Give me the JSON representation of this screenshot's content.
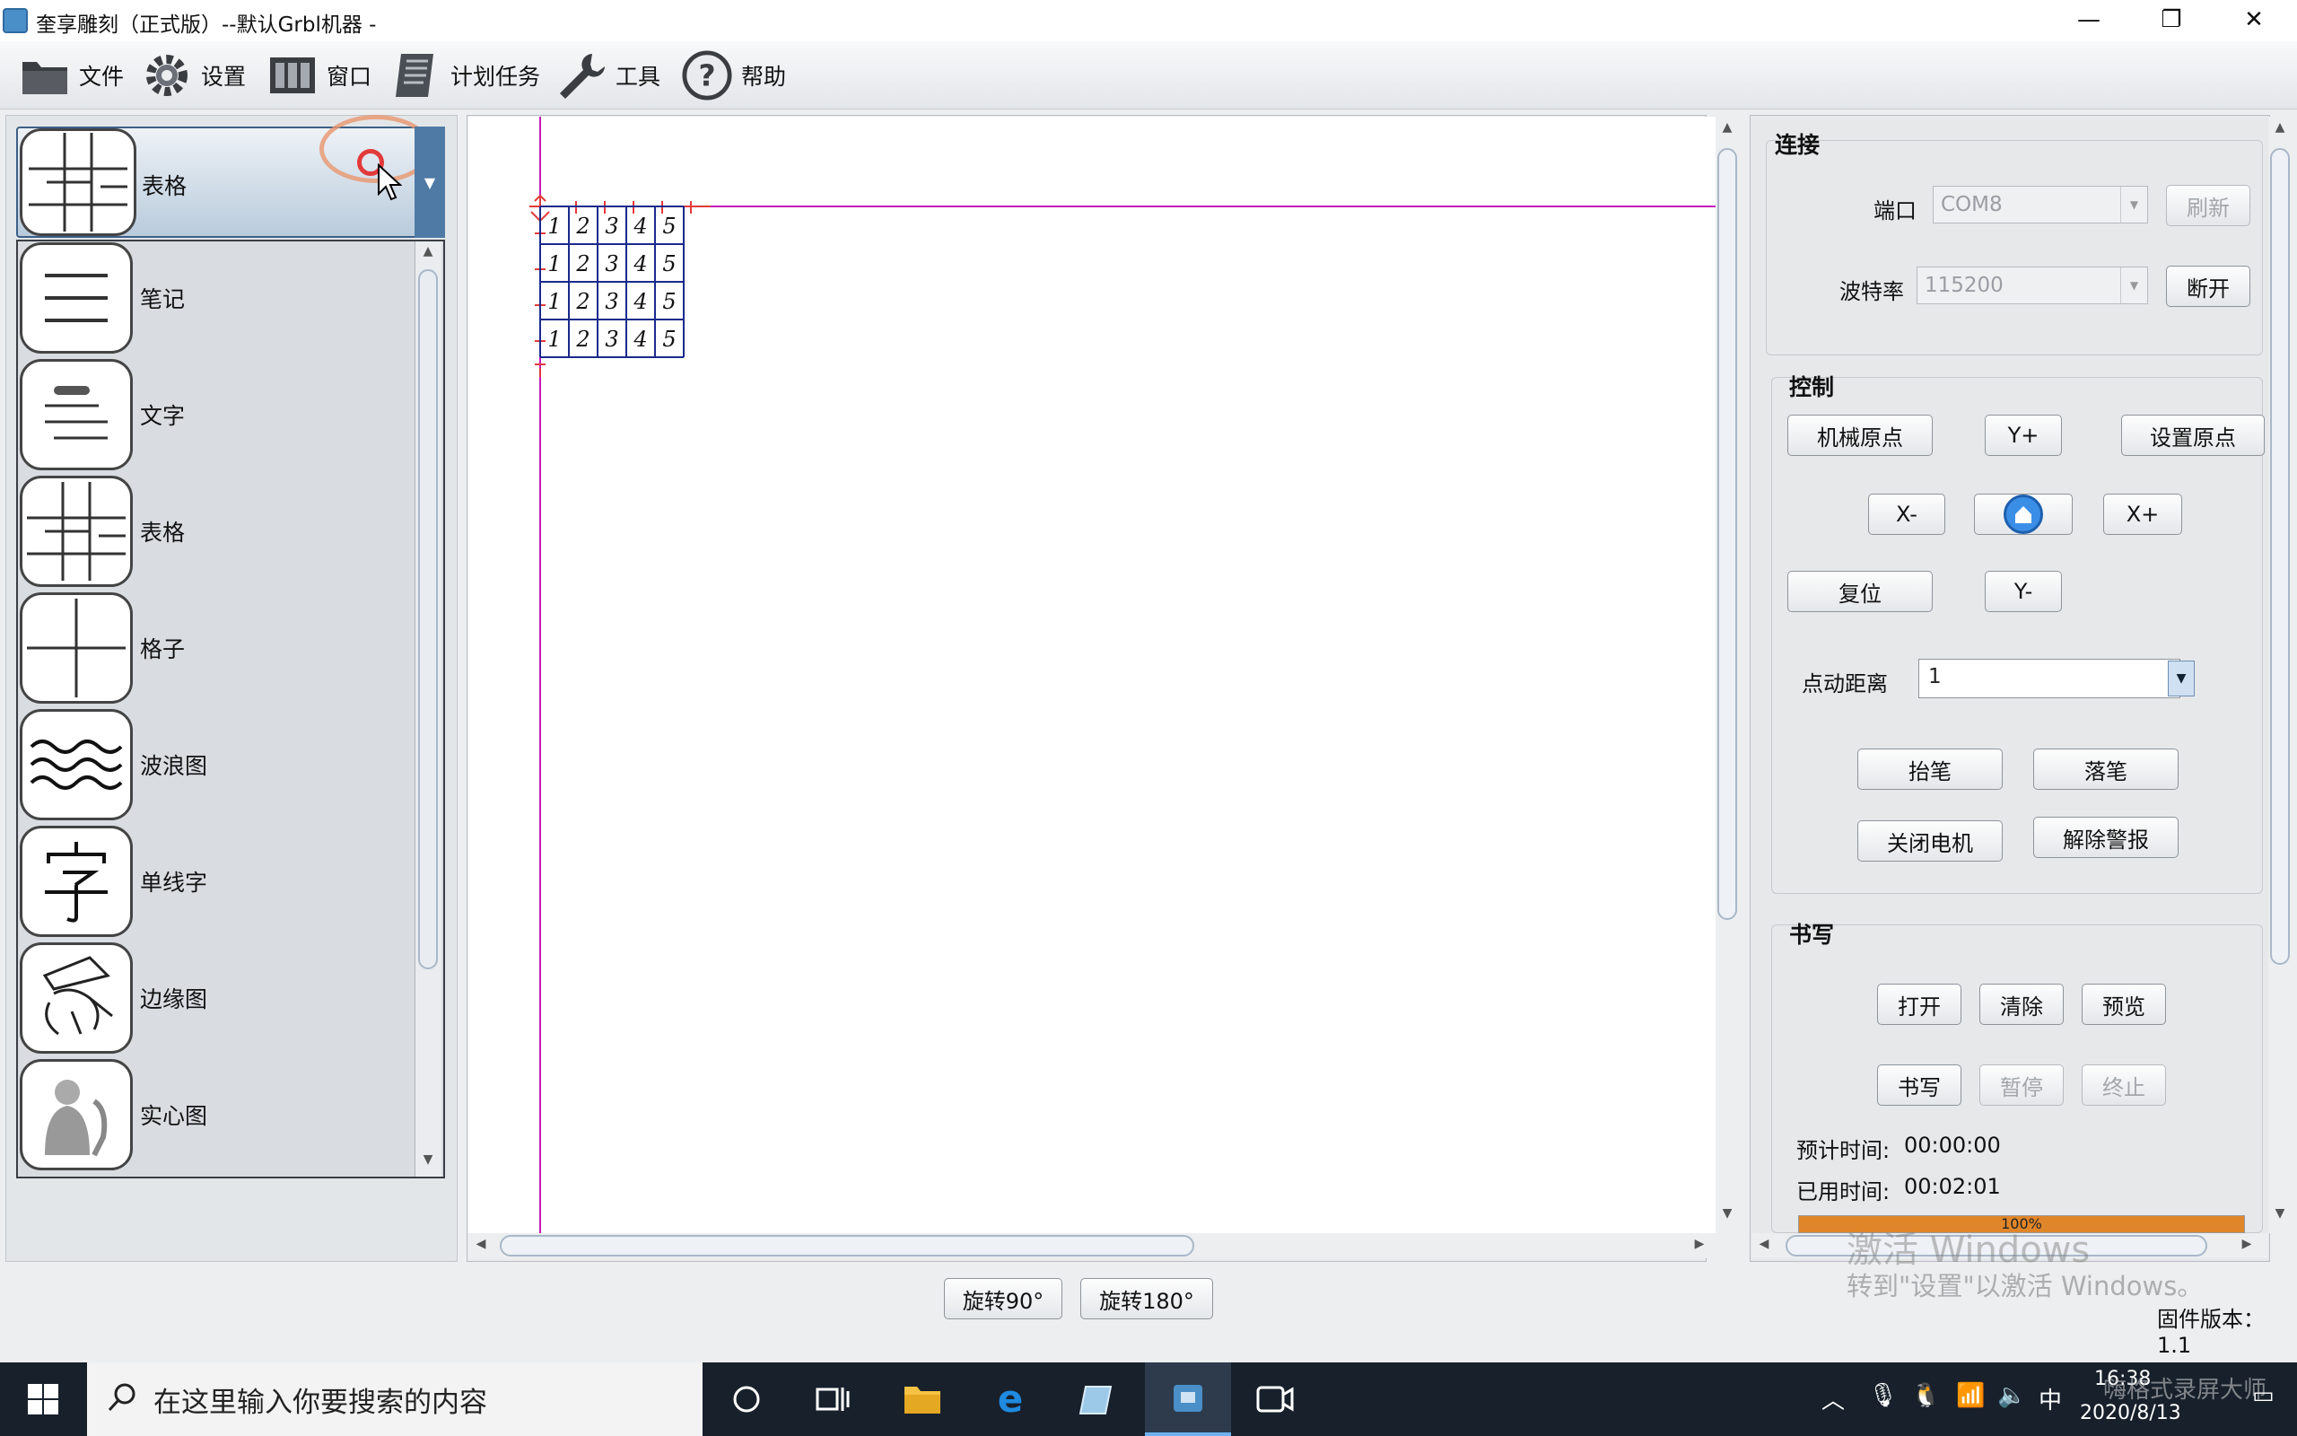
{
  "window": {
    "title": "奎享雕刻（正式版）--默认Grbl机器 -",
    "minimize": "—",
    "maximize": "❐",
    "close": "✕"
  },
  "menu": [
    {
      "label": "文件",
      "icon": "folder-icon"
    },
    {
      "label": "设置",
      "icon": "gear-icon"
    },
    {
      "label": "窗口",
      "icon": "window-icon"
    },
    {
      "label": "计划任务",
      "icon": "scroll-icon"
    },
    {
      "label": "工具",
      "icon": "wrench-icon"
    },
    {
      "label": "帮助",
      "icon": "help-icon"
    }
  ],
  "left": {
    "selected": "表格",
    "items": [
      "笔记",
      "文字",
      "表格",
      "格子",
      "波浪图",
      "单线字",
      "边缘图",
      "实心图"
    ]
  },
  "canvas": {
    "grid_rows": [
      [
        "1",
        "2",
        "3",
        "4",
        "5"
      ],
      [
        "1",
        "2",
        "3",
        "4",
        "5"
      ],
      [
        "1",
        "2",
        "3",
        "4",
        "5"
      ],
      [
        "1",
        "2",
        "3",
        "4",
        "5"
      ]
    ]
  },
  "connection": {
    "title": "连接",
    "port_label": "端口",
    "port_value": "COM8",
    "refresh": "刷新",
    "baud_label": "波特率",
    "baud_value": "115200",
    "disconnect": "断开"
  },
  "control": {
    "title": "控制",
    "home": "机械原点",
    "y_plus": "Y+",
    "set_origin": "设置原点",
    "x_minus": "X-",
    "x_plus": "X+",
    "reset": "复位",
    "y_minus": "Y-",
    "jog_label": "点动距离",
    "jog_value": "1",
    "pen_up": "抬笔",
    "pen_down": "落笔",
    "motor_off": "关闭电机",
    "clear_alarm": "解除警报"
  },
  "writing": {
    "title": "书写",
    "open": "打开",
    "clear": "清除",
    "preview": "预览",
    "write": "书写",
    "pause": "暂停",
    "stop": "终止",
    "estimated_label": "预计时间:",
    "estimated_value": "00:00:00",
    "used_label": "已用时间:",
    "used_value": "00:02:01",
    "progress_text": "100%",
    "progress": 1.0
  },
  "bottom": {
    "rotate90": "旋转90°",
    "rotate180": "旋转180°",
    "firmware": "固件版本：1.1",
    "watermark_title": "激活 Windows",
    "watermark_sub": "转到\"设置\"以激活 Windows。"
  },
  "taskbar": {
    "search_placeholder": "在这里输入你要搜索的内容",
    "ime": "中",
    "time": "16:38",
    "date": "2020/8/13",
    "recorder_watermark": "嗨格式录屏大师"
  },
  "colors": {
    "accent_border": "#3c5f86",
    "grid_blue": "#1a2a8c",
    "axis_magenta": "#c21ab8",
    "progress_orange": "#e0862a"
  }
}
